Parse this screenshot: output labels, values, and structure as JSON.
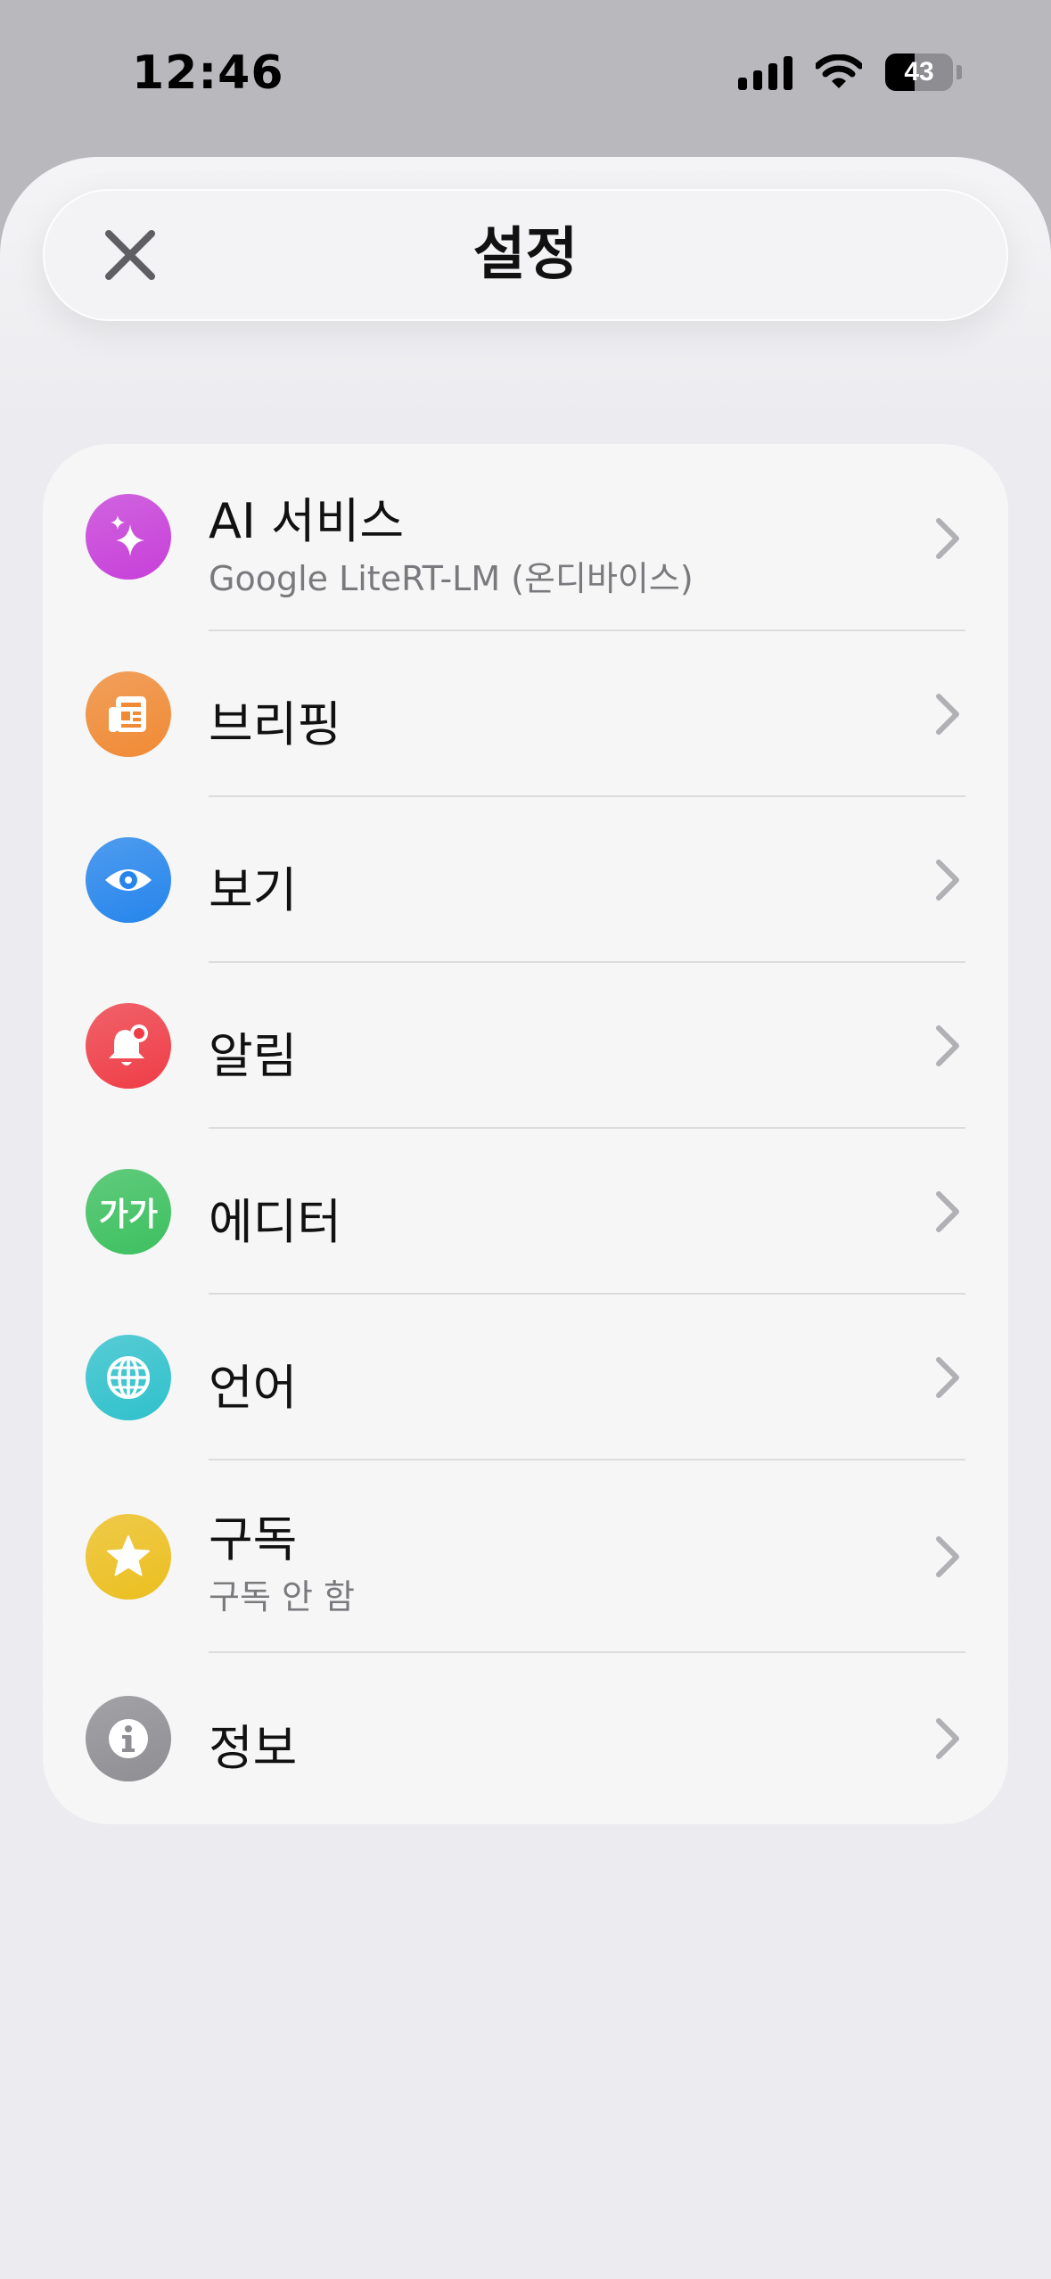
{
  "status_bar": {
    "time": "12:46",
    "battery_level": 43
  },
  "header": {
    "title": "설정",
    "close_icon": "close-icon"
  },
  "settings": [
    {
      "id": "ai",
      "label": "AI 서비스",
      "subtitle": "Google LiteRT-LM (온디바이스)",
      "icon": "sparkles-icon",
      "color": "#c73fd9"
    },
    {
      "id": "briefing",
      "label": "브리핑",
      "icon": "newspaper-icon",
      "color": "#f08a35"
    },
    {
      "id": "view",
      "label": "보기",
      "icon": "eye-icon",
      "color": "#2585ec"
    },
    {
      "id": "notifications",
      "label": "알림",
      "icon": "bell-badge-icon",
      "color": "#ef3d47"
    },
    {
      "id": "editor",
      "label": "에디터",
      "icon_text": "가가",
      "icon": "text-size-icon",
      "color": "#3cc05f"
    },
    {
      "id": "language",
      "label": "언어",
      "icon": "globe-icon",
      "color": "#2fc1cc"
    },
    {
      "id": "subscription",
      "label": "구독",
      "subtitle": "구독 안 함",
      "icon": "star-icon",
      "color": "#ecbf1f"
    },
    {
      "id": "about",
      "label": "정보",
      "icon": "info-icon",
      "color": "#8e8e93"
    }
  ]
}
